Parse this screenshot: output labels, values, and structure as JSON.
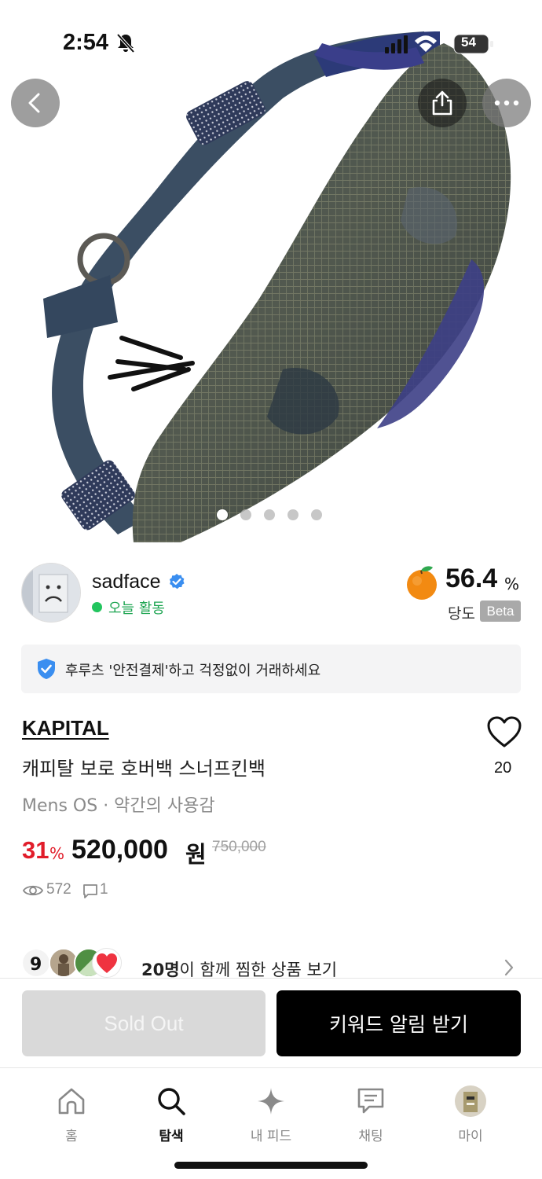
{
  "status_bar": {
    "time": "2:54",
    "battery": "54"
  },
  "image_carousel": {
    "count": 5,
    "active_index": 0
  },
  "seller": {
    "name": "sadface",
    "activity": "오늘 활동",
    "sweetness_value": "56.4",
    "sweetness_unit": "%",
    "sweetness_label": "당도",
    "beta_label": "Beta"
  },
  "safe_payment": {
    "text": "후루츠 '안전결제'하고 걱정없이 거래하세요"
  },
  "product": {
    "brand": "KAPITAL",
    "title": "캐피탈 보로 호버백 스너프킨백",
    "meta": "Mens OS · 약간의 사용감",
    "like_count": "20",
    "discount_value": "31",
    "discount_unit": "%",
    "price": "520,000",
    "price_unit": "원",
    "original_price": "750,000",
    "views": "572",
    "comments": "1"
  },
  "together": {
    "count_text": "20명",
    "rest_text": "이 함께 찜한 상품 보기"
  },
  "actions": {
    "sold_out_label": "Sold Out",
    "keyword_alert_label": "키워드 알림 받기"
  },
  "tab_bar": {
    "items": [
      {
        "label": "홈",
        "icon": "home-icon"
      },
      {
        "label": "탐색",
        "icon": "search-icon"
      },
      {
        "label": "내 피드",
        "icon": "sparkle-icon"
      },
      {
        "label": "채팅",
        "icon": "chat-icon"
      },
      {
        "label": "마이",
        "icon": "profile-avatar-icon"
      }
    ],
    "active_index": 1
  },
  "colors": {
    "discount": "#e11d2a",
    "activity_green": "#22c55e",
    "verified_blue": "#3a8ef0",
    "shield_blue": "#3a8ef0",
    "sold_out_bg": "#d9d9d9",
    "primary_button_bg": "#000000"
  }
}
